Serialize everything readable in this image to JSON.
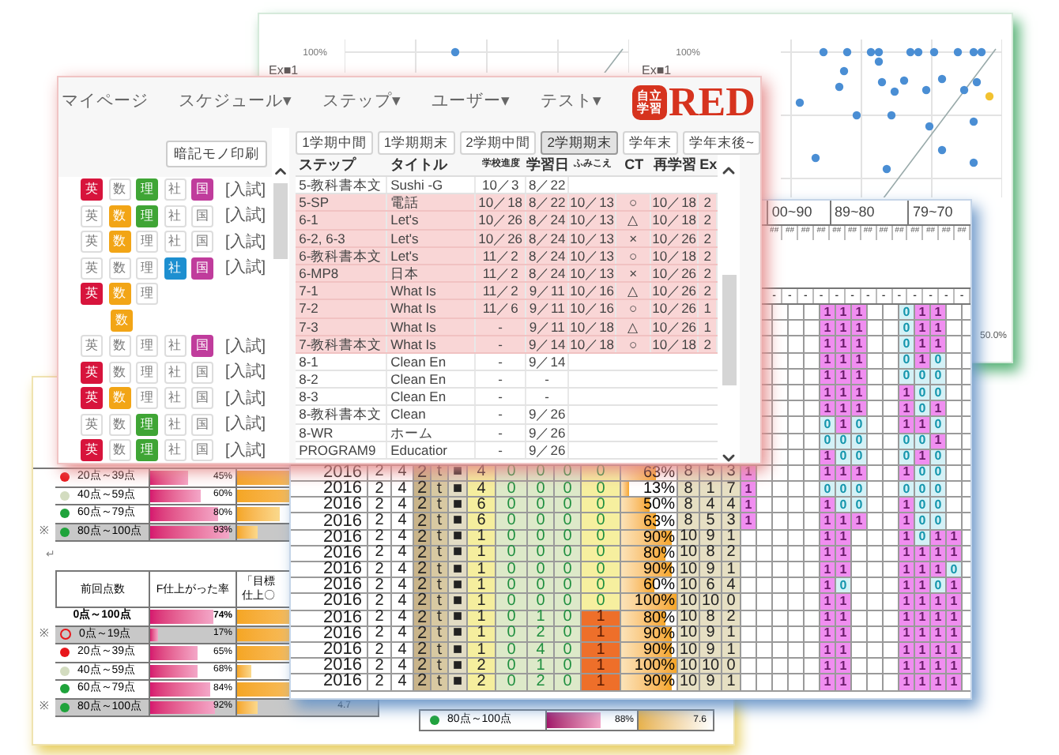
{
  "chart_panel": {
    "plots": [
      {
        "legend": "Ex■1",
        "ytick": "100%"
      },
      {
        "legend": "Ex■1",
        "ytick": "100%",
        "xtick": "50.0%"
      }
    ]
  },
  "report": {
    "table1": {
      "rows": [
        {
          "kind": "dot",
          "color": "#e8161b",
          "range": "20点～39点",
          "pct": "45%",
          "level": 0.45,
          "goal": {
            "level": 1
          },
          "highlighted": false
        },
        {
          "kind": "dot",
          "color": "#d3dcc0",
          "range": "40点～59点",
          "pct": "60%",
          "level": 0.6,
          "goal": {
            "level": 1
          },
          "highlighted": false
        },
        {
          "kind": "dot",
          "color": "#1fa33b",
          "range": "60点～79点",
          "pct": "80%",
          "level": 0.8,
          "goal": {
            "level": 0.3
          },
          "highlighted": false
        },
        {
          "kind": "dot",
          "color": "#1fa33b",
          "range": "80点～100点",
          "pct": "93%",
          "level": 0.93,
          "goal": {
            "level": 0.15
          },
          "highlighted": true,
          "mark": "※"
        }
      ]
    },
    "paragraph_mark": "↵",
    "table2": {
      "columns": [
        "前回点数",
        "F仕上がった率",
        "「目標仕上〇"
      ],
      "rows": [
        {
          "kind": "total",
          "range": "0点～100点",
          "pct": "74%",
          "level": 0.74,
          "goal": {
            "level": 0.9
          },
          "highlighted": false
        },
        {
          "kind": "ring",
          "color": "#e8161b",
          "range": "0点～19点",
          "pct": "17%",
          "level": 0.1,
          "goal": {
            "level": 0.9
          },
          "highlighted": true,
          "mark": "※"
        },
        {
          "kind": "dot",
          "color": "#e8161b",
          "range": "20点～39点",
          "pct": "65%",
          "level": 0.55,
          "goal": {
            "level": 0.9
          },
          "highlighted": false
        },
        {
          "kind": "dot",
          "color": "#d3dcc0",
          "range": "40点～59点",
          "pct": "68%",
          "level": 0.55,
          "goal": {
            "level": 0.1
          },
          "highlighted": false
        },
        {
          "kind": "dot",
          "color": "#1fa33b",
          "range": "60点～79点",
          "pct": "84%",
          "level": 0.7,
          "goal": {
            "level": 0.9
          },
          "highlighted": false
        },
        {
          "kind": "dot",
          "color": "#1fa33b",
          "range": "80点～100点",
          "pct": "92%",
          "level": 0.75,
          "goal": {
            "level": 0.15
          },
          "highlighted": true,
          "mark": "※",
          "value": "4.7"
        }
      ]
    },
    "side_row": {
      "kind": "dot",
      "color": "#1fa33b",
      "range": "80点～100点",
      "pct": "88%",
      "level": 0.6,
      "value": "7.6"
    }
  },
  "spreadsheet": {
    "groups": [
      {
        "label": "00~90",
        "marks": [
          "##",
          "##",
          "##",
          "##"
        ],
        "dashes": [
          "-",
          "-",
          "-",
          "-"
        ]
      },
      {
        "label": "89~80",
        "marks": [
          "##",
          "##",
          "##",
          "##",
          "##"
        ],
        "dashes": [
          "-",
          "-",
          "-",
          "-",
          "-"
        ]
      },
      {
        "label": "79~70",
        "marks": [
          "##",
          "##",
          "##",
          "##"
        ],
        "dashes": [
          "-",
          "-",
          "-",
          "-"
        ]
      }
    ],
    "upper_rows": [
      {
        "flags": {
          "band_2": [
            "1",
            "1",
            "1"
          ],
          "band_3": [
            "0",
            "1",
            "1"
          ]
        },
        "hits": {
          "band_2": [
            true,
            true,
            true
          ],
          "band_3": [
            false,
            true,
            true
          ]
        }
      },
      {
        "flags": {
          "band_2": [
            "1",
            "1",
            "1"
          ],
          "band_3": [
            "0",
            "1",
            "1"
          ]
        },
        "hits": {
          "band_2": [
            true,
            true,
            true
          ],
          "band_3": [
            false,
            true,
            true
          ]
        }
      },
      {
        "flags": {
          "band_2": [
            "1",
            "1",
            "1"
          ],
          "band_3": [
            "0",
            "1",
            "1"
          ]
        },
        "hits": {
          "band_2": [
            true,
            true,
            true
          ],
          "band_3": [
            false,
            true,
            true
          ]
        }
      },
      {
        "flags": {
          "band_2": [
            "1",
            "1",
            "1"
          ],
          "band_3": [
            "0",
            "1",
            "0"
          ]
        },
        "hits": {
          "band_2": [
            true,
            true,
            true
          ],
          "band_3": [
            false,
            true,
            false
          ]
        }
      },
      {
        "flags": {
          "band_2": [
            "1",
            "1",
            "1"
          ],
          "band_3": [
            "0",
            "0",
            "0"
          ]
        },
        "hits": {
          "band_2": [
            true,
            true,
            true
          ],
          "band_3": [
            false,
            false,
            false
          ]
        }
      },
      {
        "flags": {
          "band_2": [
            "1",
            "1",
            "1"
          ],
          "band_3": [
            "1",
            "0",
            "0"
          ]
        },
        "hits": {
          "band_2": [
            true,
            true,
            true
          ],
          "band_3": [
            true,
            false,
            false
          ]
        }
      },
      {
        "flags": {
          "band_2": [
            "1",
            "1",
            "1"
          ],
          "band_3": [
            "1",
            "0",
            "1"
          ]
        },
        "hits": {
          "band_2": [
            true,
            true,
            true
          ],
          "band_3": [
            true,
            false,
            true
          ]
        }
      },
      {
        "flags": {
          "band_2": [
            "0",
            "1",
            "0"
          ],
          "band_3": [
            "1",
            "1",
            "0"
          ]
        },
        "hits": {
          "band_2": [
            false,
            true,
            false
          ],
          "band_3": [
            true,
            true,
            false
          ]
        }
      },
      {
        "flags": {
          "band_2": [
            "0",
            "0",
            "0"
          ],
          "band_3": [
            "0",
            "0",
            "1"
          ]
        },
        "hits": {
          "band_2": [
            false,
            false,
            false
          ],
          "band_3": [
            false,
            false,
            true
          ]
        }
      },
      {
        "flags": {
          "band_2": [
            "1",
            "0",
            "0"
          ],
          "band_3": [
            "0",
            "1",
            "0"
          ]
        },
        "hits": {
          "band_2": [
            true,
            false,
            false
          ],
          "band_3": [
            false,
            true,
            false
          ]
        }
      }
    ],
    "rows": [
      {
        "cells": [
          "2016",
          "2",
          "4",
          "2",
          "ｔ",
          "■",
          "4",
          "0",
          "0",
          "0",
          "0",
          "63%",
          "8",
          "5",
          "3"
        ],
        "pct_bar": {
          "level": 0.63
        },
        "alert": false,
        "flags": {
          "lead": [
            "1"
          ],
          "band_2": [
            "1",
            "1",
            "1"
          ],
          "band_3": [
            "1",
            "0",
            "0"
          ]
        },
        "hits": {
          "lead": [
            true
          ],
          "band_2": [
            true,
            true,
            true
          ],
          "band_3": [
            true,
            false,
            false
          ]
        }
      },
      {
        "cells": [
          "2016",
          "2",
          "4",
          "2",
          "ｔ",
          "■",
          "4",
          "0",
          "0",
          "0",
          "0",
          "13%",
          "8",
          "1",
          "7"
        ],
        "pct_bar": {
          "level": 0.13
        },
        "alert": false,
        "flags": {
          "lead": [
            "1"
          ],
          "band_2": [
            "0",
            "0",
            "0"
          ],
          "band_3": [
            "0",
            "0",
            "0"
          ]
        },
        "hits": {
          "lead": [
            true
          ],
          "band_2": [
            false,
            false,
            false
          ],
          "band_3": [
            false,
            false,
            false
          ]
        }
      },
      {
        "cells": [
          "2016",
          "2",
          "4",
          "2",
          "ｔ",
          "■",
          "6",
          "0",
          "0",
          "0",
          "0",
          "50%",
          "8",
          "4",
          "4"
        ],
        "pct_bar": {
          "level": 0.5
        },
        "alert": false,
        "flags": {
          "lead": [
            "1"
          ],
          "band_2": [
            "1",
            "0",
            "0"
          ],
          "band_3": [
            "1",
            "0",
            "0"
          ]
        },
        "hits": {
          "lead": [
            true
          ],
          "band_2": [
            true,
            false,
            false
          ],
          "band_3": [
            true,
            false,
            false
          ]
        }
      },
      {
        "cells": [
          "2016",
          "2",
          "4",
          "2",
          "ｔ",
          "■",
          "6",
          "0",
          "0",
          "0",
          "0",
          "63%",
          "8",
          "5",
          "3"
        ],
        "pct_bar": {
          "level": 0.63
        },
        "alert": false,
        "flags": {
          "lead": [
            "1"
          ],
          "band_2": [
            "1",
            "1",
            "1"
          ],
          "band_3": [
            "1",
            "0",
            "0"
          ]
        },
        "hits": {
          "lead": [
            true
          ],
          "band_2": [
            true,
            true,
            true
          ],
          "band_3": [
            true,
            false,
            false
          ]
        }
      },
      {
        "cells": [
          "2016",
          "2",
          "4",
          "2",
          "ｔ",
          "■",
          "1",
          "0",
          "0",
          "0",
          "0",
          "90%",
          "10",
          "9",
          "1"
        ],
        "pct_bar": {
          "level": 0.9
        },
        "alert": false,
        "flags": {
          "band_2": [
            "1",
            "1"
          ],
          "band_3": [
            "1",
            "0",
            "1",
            "1"
          ]
        },
        "hits": {
          "band_2": [
            true,
            true
          ],
          "band_3": [
            true,
            false,
            true,
            true
          ]
        }
      },
      {
        "cells": [
          "2016",
          "2",
          "4",
          "2",
          "ｔ",
          "■",
          "1",
          "0",
          "0",
          "0",
          "0",
          "80%",
          "10",
          "8",
          "2"
        ],
        "pct_bar": {
          "level": 0.8
        },
        "alert": false,
        "flags": {
          "band_2": [
            "1",
            "1"
          ],
          "band_3": [
            "1",
            "1",
            "1",
            "1"
          ]
        },
        "hits": {
          "band_2": [
            true,
            true
          ],
          "band_3": [
            true,
            true,
            true,
            true
          ]
        }
      },
      {
        "cells": [
          "2016",
          "2",
          "4",
          "2",
          "ｔ",
          "■",
          "1",
          "0",
          "0",
          "0",
          "0",
          "90%",
          "10",
          "9",
          "1"
        ],
        "pct_bar": {
          "level": 0.9
        },
        "alert": false,
        "flags": {
          "band_2": [
            "1",
            "1"
          ],
          "band_3": [
            "1",
            "1",
            "1",
            "0"
          ]
        },
        "hits": {
          "band_2": [
            true,
            true
          ],
          "band_3": [
            true,
            true,
            true,
            false
          ]
        }
      },
      {
        "cells": [
          "2016",
          "2",
          "4",
          "2",
          "ｔ",
          "■",
          "1",
          "0",
          "0",
          "0",
          "0",
          "60%",
          "10",
          "6",
          "4"
        ],
        "pct_bar": {
          "level": 0.6
        },
        "alert": false,
        "flags": {
          "band_2": [
            "1",
            "0"
          ],
          "band_3": [
            "1",
            "1",
            "0",
            "1"
          ]
        },
        "hits": {
          "band_2": [
            true,
            false
          ],
          "band_3": [
            true,
            true,
            false,
            true
          ]
        }
      },
      {
        "cells": [
          "2016",
          "2",
          "4",
          "2",
          "ｔ",
          "■",
          "1",
          "0",
          "0",
          "0",
          "0",
          "100%",
          "10",
          "10",
          "0"
        ],
        "pct_bar": {
          "level": 1
        },
        "alert": false,
        "flags": {
          "band_2": [
            "1",
            "1"
          ],
          "band_3": [
            "1",
            "1",
            "1",
            "1"
          ]
        },
        "hits": {
          "band_2": [
            true,
            true
          ],
          "band_3": [
            true,
            true,
            true,
            true
          ]
        }
      },
      {
        "cells": [
          "2016",
          "2",
          "4",
          "2",
          "ｔ",
          "■",
          "1",
          "0",
          "1",
          "0",
          "1",
          "80%",
          "10",
          "8",
          "2"
        ],
        "pct_bar": {
          "level": 0.8
        },
        "alert": true,
        "flags": {
          "band_2": [
            "1",
            "1"
          ],
          "band_3": [
            "1",
            "1",
            "1",
            "1"
          ]
        },
        "hits": {
          "band_2": [
            true,
            true
          ],
          "band_3": [
            true,
            true,
            true,
            true
          ]
        }
      },
      {
        "cells": [
          "2016",
          "2",
          "4",
          "2",
          "ｔ",
          "■",
          "1",
          "0",
          "2",
          "0",
          "1",
          "90%",
          "10",
          "9",
          "1"
        ],
        "pct_bar": {
          "level": 0.9
        },
        "alert": true,
        "flags": {
          "band_2": [
            "1",
            "1"
          ],
          "band_3": [
            "1",
            "1",
            "1",
            "1"
          ]
        },
        "hits": {
          "band_2": [
            true,
            true
          ],
          "band_3": [
            true,
            true,
            true,
            true
          ]
        }
      },
      {
        "cells": [
          "2016",
          "2",
          "4",
          "2",
          "ｔ",
          "■",
          "1",
          "0",
          "4",
          "0",
          "1",
          "90%",
          "10",
          "9",
          "1"
        ],
        "pct_bar": {
          "level": 0.9
        },
        "alert": true,
        "flags": {
          "band_2": [
            "1",
            "1"
          ],
          "band_3": [
            "1",
            "1",
            "1",
            "1"
          ]
        },
        "hits": {
          "band_2": [
            true,
            true
          ],
          "band_3": [
            true,
            true,
            true,
            true
          ]
        }
      },
      {
        "cells": [
          "2016",
          "2",
          "4",
          "2",
          "ｔ",
          "■",
          "2",
          "0",
          "1",
          "0",
          "1",
          "100%",
          "10",
          "10",
          "0"
        ],
        "pct_bar": {
          "level": 1
        },
        "alert": true,
        "flags": {
          "band_2": [
            "1",
            "1"
          ],
          "band_3": [
            "1",
            "1",
            "1",
            "1"
          ]
        },
        "hits": {
          "band_2": [
            true,
            true
          ],
          "band_3": [
            true,
            true,
            true,
            true
          ]
        }
      },
      {
        "cells": [
          "2016",
          "2",
          "4",
          "2",
          "ｔ",
          "■",
          "2",
          "0",
          "2",
          "0",
          "1",
          "90%",
          "10",
          "9",
          "1"
        ],
        "pct_bar": {
          "level": 0.9
        },
        "alert": true,
        "flags": {
          "band_2": [
            "1",
            "1"
          ],
          "band_3": [
            "1",
            "1",
            "1",
            "1"
          ]
        },
        "hits": {
          "band_2": [
            true,
            true
          ],
          "band_3": [
            true,
            true,
            true,
            true
          ]
        }
      }
    ]
  },
  "app_window": {
    "nav": [
      "マイページ",
      "スケジュール▾",
      "ステップ▾",
      "ユーザー▾",
      "テスト▾"
    ],
    "logo": {
      "badge": "自立学習",
      "name": "RED"
    },
    "print_button": "暗記モノ印刷",
    "subject_rows": [
      {
        "kind": "full",
        "cells": [
          {
            "label": "英",
            "color": "#d7143c",
            "on": true
          },
          {
            "label": "数",
            "on": false
          },
          {
            "label": "理",
            "color": "#3fa535",
            "on": true
          },
          {
            "label": "社",
            "on": false
          },
          {
            "label": "国",
            "color": "#c03c9c",
            "on": true
          }
        ],
        "tag": "[入試]"
      },
      {
        "kind": "full",
        "cells": [
          {
            "label": "英",
            "on": false
          },
          {
            "label": "数",
            "color": "#f2a516",
            "on": true
          },
          {
            "label": "理",
            "color": "#3fa535",
            "on": true
          },
          {
            "label": "社",
            "on": false
          },
          {
            "label": "国",
            "on": false
          }
        ],
        "tag": "[入試]"
      },
      {
        "kind": "full",
        "cells": [
          {
            "label": "英",
            "on": false
          },
          {
            "label": "数",
            "color": "#f2a516",
            "on": true
          },
          {
            "label": "理",
            "on": false
          },
          {
            "label": "社",
            "on": false
          },
          {
            "label": "国",
            "on": false
          }
        ],
        "tag": "[入試]"
      },
      {
        "kind": "full",
        "cells": [
          {
            "label": "英",
            "on": false
          },
          {
            "label": "数",
            "on": false
          },
          {
            "label": "理",
            "on": false
          },
          {
            "label": "社",
            "color": "#1d8fd0",
            "on": true
          },
          {
            "label": "国",
            "color": "#c03c9c",
            "on": true
          }
        ],
        "tag": "[入試]"
      },
      {
        "kind": "full",
        "cells": [
          {
            "label": "英",
            "color": "#d7143c",
            "on": true
          },
          {
            "label": "数",
            "color": "#f2a516",
            "on": true
          },
          {
            "label": "理",
            "on": false
          }
        ]
      },
      {
        "kind": "sub",
        "cells": [
          {
            "label": "数",
            "color": "#f2a516",
            "on": true
          }
        ]
      },
      {
        "kind": "full",
        "cells": [
          {
            "label": "英",
            "on": false
          },
          {
            "label": "数",
            "on": false
          },
          {
            "label": "理",
            "on": false
          },
          {
            "label": "社",
            "on": false
          },
          {
            "label": "国",
            "color": "#c03c9c",
            "on": true
          }
        ],
        "tag": "[入試]"
      },
      {
        "kind": "full",
        "cells": [
          {
            "label": "英",
            "color": "#d7143c",
            "on": true
          },
          {
            "label": "数",
            "on": false
          },
          {
            "label": "理",
            "on": false
          },
          {
            "label": "社",
            "on": false
          },
          {
            "label": "国",
            "on": false
          }
        ],
        "tag": "[入試]"
      },
      {
        "kind": "full",
        "cells": [
          {
            "label": "英",
            "color": "#d7143c",
            "on": true
          },
          {
            "label": "数",
            "color": "#f2a516",
            "on": true
          },
          {
            "label": "理",
            "on": false
          },
          {
            "label": "社",
            "on": false
          },
          {
            "label": "国",
            "on": false
          }
        ],
        "tag": "[入試]"
      },
      {
        "kind": "full",
        "cells": [
          {
            "label": "英",
            "on": false
          },
          {
            "label": "数",
            "on": false
          },
          {
            "label": "理",
            "color": "#3fa535",
            "on": true
          },
          {
            "label": "社",
            "on": false
          },
          {
            "label": "国",
            "on": false
          }
        ],
        "tag": "[入試]"
      },
      {
        "kind": "full",
        "cells": [
          {
            "label": "英",
            "color": "#d7143c",
            "on": true
          },
          {
            "label": "数",
            "on": false
          },
          {
            "label": "理",
            "color": "#3fa535",
            "on": true
          },
          {
            "label": "社",
            "on": false
          },
          {
            "label": "国",
            "on": false
          }
        ],
        "tag": "[入試]"
      }
    ],
    "tabs": [
      {
        "label": "1学期中間",
        "selected": false
      },
      {
        "label": "1学期期末",
        "selected": false
      },
      {
        "label": "2学期中間",
        "selected": false
      },
      {
        "label": "2学期期末",
        "selected": true
      },
      {
        "label": "学年末",
        "selected": false
      },
      {
        "label": "学年末後~",
        "selected": false
      }
    ],
    "columns": [
      "ステップ",
      "タイトル",
      "学校進度",
      "学習日",
      "ふみこえ",
      "CT",
      "再学習",
      "Ex"
    ],
    "rows": [
      {
        "cells": [
          "5-教科書本文",
          "Sushi -G",
          "10／3",
          "8／22"
        ],
        "highlighted": false
      },
      {
        "cells": [
          "5-SP",
          "電話",
          "10／18",
          "8／22",
          "10／13",
          "○",
          "10／18",
          "2"
        ],
        "highlighted": true
      },
      {
        "cells": [
          "6-1",
          "Let's",
          "10／26",
          "8／24",
          "10／13",
          "△",
          "10／18",
          "2"
        ],
        "highlighted": true
      },
      {
        "cells": [
          "6-2, 6-3",
          "Let's",
          "10／26",
          "8／24",
          "10／13",
          "×",
          "10／26",
          "2"
        ],
        "highlighted": true
      },
      {
        "cells": [
          "6-教科書本文",
          "Let's",
          "11／2",
          "8／24",
          "10／13",
          "○",
          "10／18",
          "2"
        ],
        "highlighted": true
      },
      {
        "cells": [
          "6-MP8",
          "日本",
          "11／2",
          "8／24",
          "10／13",
          "×",
          "10／26",
          "2"
        ],
        "highlighted": true
      },
      {
        "cells": [
          "7-1",
          "What Is",
          "11／2",
          "9／11",
          "10／16",
          "△",
          "10／26",
          "2"
        ],
        "highlighted": true
      },
      {
        "cells": [
          "7-2",
          "What Is",
          "11／6",
          "9／11",
          "10／16",
          "○",
          "10／26",
          "1"
        ],
        "highlighted": true
      },
      {
        "cells": [
          "7-3",
          "What Is",
          "-",
          "9／11",
          "10／18",
          "△",
          "10／26",
          "1"
        ],
        "highlighted": true
      },
      {
        "cells": [
          "7-教科書本文",
          "What Is",
          "-",
          "9／14",
          "10／18",
          "○",
          "10／18",
          "2"
        ],
        "highlighted": true
      },
      {
        "cells": [
          "8-1",
          "Clean En",
          "-",
          "9／14"
        ],
        "highlighted": false
      },
      {
        "cells": [
          "8-2",
          "Clean En",
          "-",
          "-"
        ],
        "highlighted": false
      },
      {
        "cells": [
          "8-3",
          "Clean En",
          "-",
          "-"
        ],
        "highlighted": false
      },
      {
        "cells": [
          "8-教科書本文",
          "Clean",
          "-",
          "9／26"
        ],
        "highlighted": false
      },
      {
        "cells": [
          "8-WR",
          "ホーム",
          "-",
          "9／26"
        ],
        "highlighted": false
      },
      {
        "cells": [
          "PROGRAM9",
          "Educatior",
          "-",
          "9／26"
        ],
        "highlighted": false
      }
    ]
  }
}
